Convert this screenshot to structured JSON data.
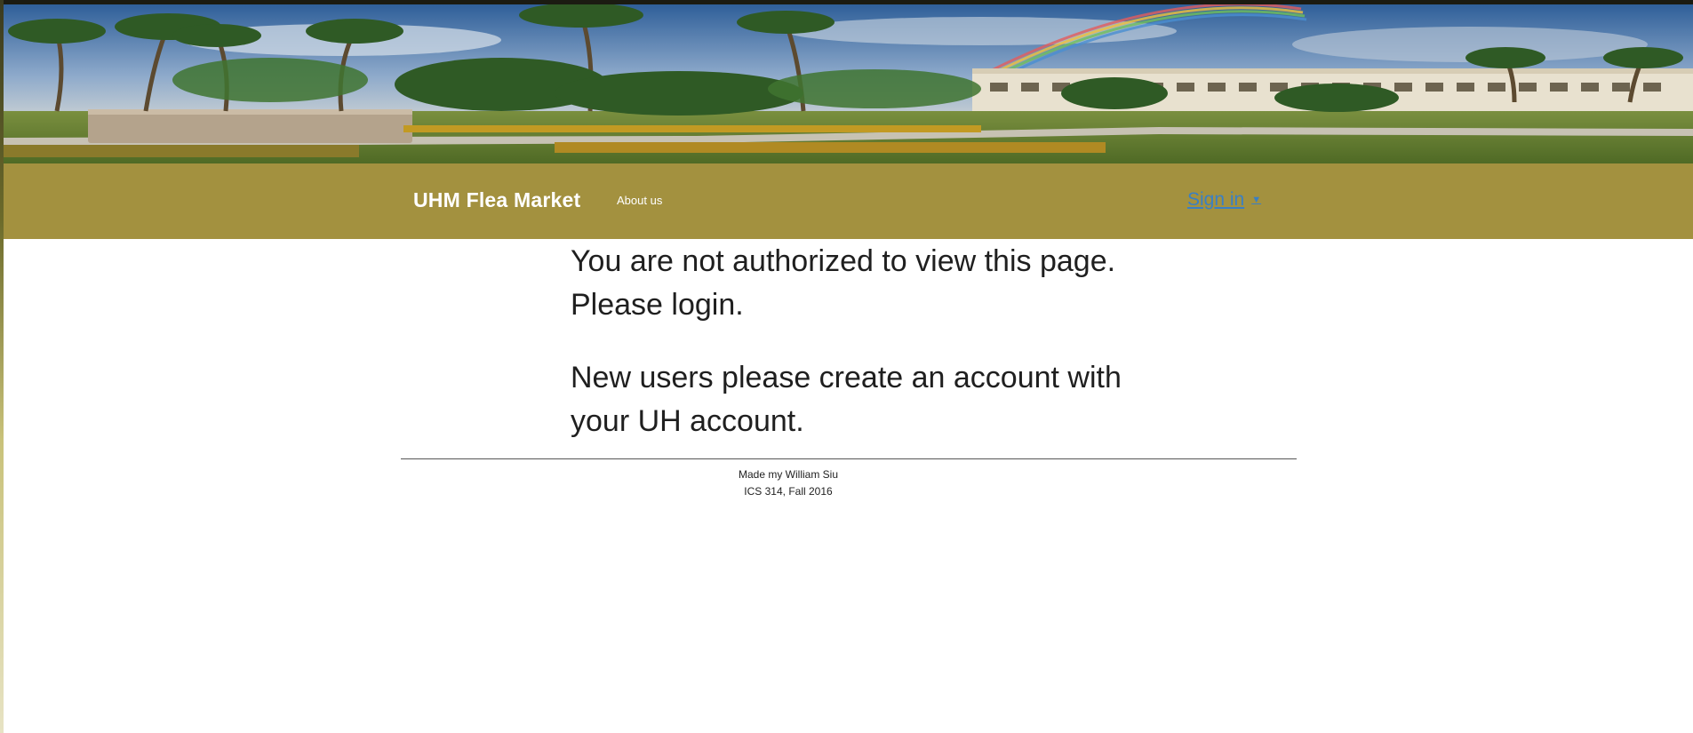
{
  "header": {
    "banner_alt": "campus banner image"
  },
  "navbar": {
    "brand": "UHM Flea Market",
    "about": "About us",
    "signin": "Sign in",
    "signin_caret": "▼"
  },
  "main": {
    "message1": "You are not authorized to view this page. Please login.",
    "message2": "New users please create an account with your UH account."
  },
  "footer": {
    "line1": "Made my William Siu",
    "line2": "ICS 314, Fall 2016"
  },
  "colors": {
    "navbar_bg": "#a3913f",
    "link": "#3a7fc4",
    "text": "#1f1f1f"
  },
  "icons": {
    "caret": "chevron-down-icon"
  }
}
